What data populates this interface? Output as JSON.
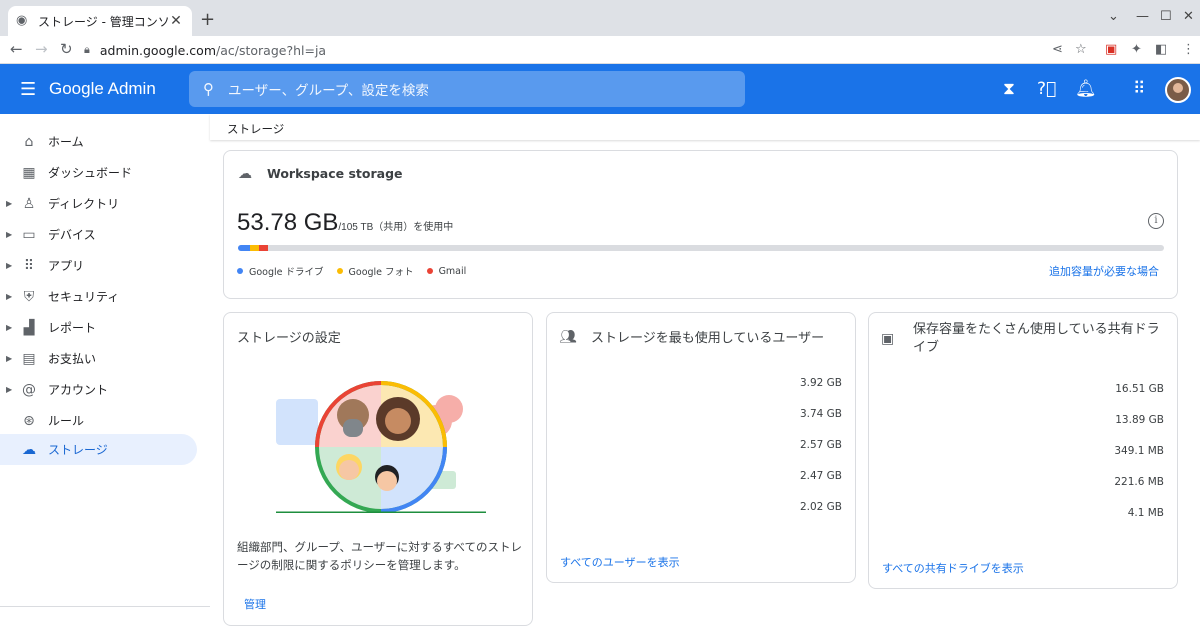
{
  "browser": {
    "tab_title": "ストレージ - 管理コンソール",
    "url_host": "admin.google.com",
    "url_path": "/ac/storage?hl=ja"
  },
  "header": {
    "brand": "Google Admin",
    "search_placeholder": "ユーザー、グループ、設定を検索"
  },
  "sidebar": {
    "items": [
      {
        "label": "ホーム",
        "icon": "home-icon",
        "expandable": false
      },
      {
        "label": "ダッシュボード",
        "icon": "dashboard-icon",
        "expandable": false
      },
      {
        "label": "ディレクトリ",
        "icon": "person-icon",
        "expandable": true
      },
      {
        "label": "デバイス",
        "icon": "devices-icon",
        "expandable": true
      },
      {
        "label": "アプリ",
        "icon": "apps-icon",
        "expandable": true
      },
      {
        "label": "セキュリティ",
        "icon": "shield-icon",
        "expandable": true
      },
      {
        "label": "レポート",
        "icon": "bar-chart-icon",
        "expandable": true
      },
      {
        "label": "お支払い",
        "icon": "credit-card-icon",
        "expandable": true
      },
      {
        "label": "アカウント",
        "icon": "at-sign-icon",
        "expandable": true
      },
      {
        "label": "ルール",
        "icon": "rules-icon",
        "expandable": false
      },
      {
        "label": "ストレージ",
        "icon": "cloud-icon",
        "expandable": false,
        "active": true
      }
    ]
  },
  "breadcrumb": "ストレージ",
  "workspace": {
    "title": "Workspace storage",
    "used": "53.78 GB",
    "total": "/105 TB（共用）を使用中",
    "legend": [
      {
        "label": "Google ドライブ",
        "color": "#4285f4"
      },
      {
        "label": "Google フォト",
        "color": "#fbbc04"
      },
      {
        "label": "Gmail",
        "color": "#ea4335"
      }
    ],
    "more_link": "追加容量が必要な場合"
  },
  "settings_card": {
    "title": "ストレージの設定",
    "description": "組織部門、グループ、ユーザーに対するすべてのストレージの制限に関するポリシーを管理します。",
    "link": "管理"
  },
  "users_card": {
    "title": "ストレージを最も使用しているユーザー",
    "values": [
      "3.92 GB",
      "3.74 GB",
      "2.57 GB",
      "2.47 GB",
      "2.02 GB"
    ],
    "link": "すべてのユーザーを表示"
  },
  "drives_card": {
    "title": "保存容量をたくさん使用している共有ドライブ",
    "values": [
      "16.51 GB",
      "13.89 GB",
      "349.1 MB",
      "221.6 MB",
      "4.1 MB"
    ],
    "link": "すべての共有ドライブを表示"
  }
}
